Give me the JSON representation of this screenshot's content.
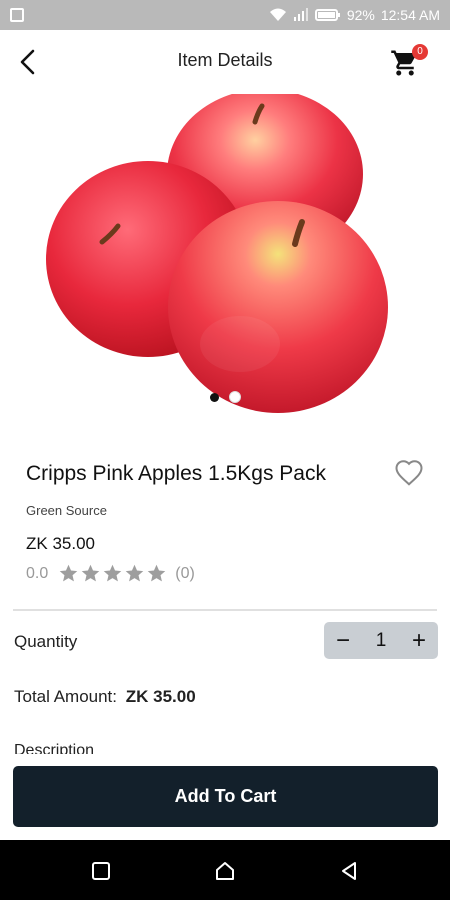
{
  "status_bar": {
    "battery": "92%",
    "time": "12:54 AM"
  },
  "header": {
    "title": "Item Details",
    "cart_count": "0"
  },
  "gallery": {
    "image": "red-pink-apples-photo",
    "page_count": 2,
    "active_index": 0
  },
  "product": {
    "name": "Cripps Pink Apples 1.5Kgs Pack",
    "brand": "Green Source",
    "price": "ZK 35.00",
    "rating_value": "0.0",
    "rating_stars": 0,
    "review_count": "(0)"
  },
  "quantity": {
    "label": "Quantity",
    "minus": "−",
    "value": "1",
    "plus": "+"
  },
  "total": {
    "label": "Total Amount:",
    "amount": "ZK 35.00"
  },
  "description": {
    "heading": "Description"
  },
  "actions": {
    "add_to_cart": "Add To Cart"
  },
  "colors": {
    "primary_button": "#13202b",
    "badge": "#e53935",
    "stepper_bg": "#c9ced3"
  },
  "icons": {
    "back": "arrow-left-icon",
    "cart": "shopping-cart-icon",
    "favorite": "heart-outline-icon",
    "nav_recent": "square-icon",
    "nav_home": "home-icon",
    "nav_back": "triangle-back-icon"
  }
}
